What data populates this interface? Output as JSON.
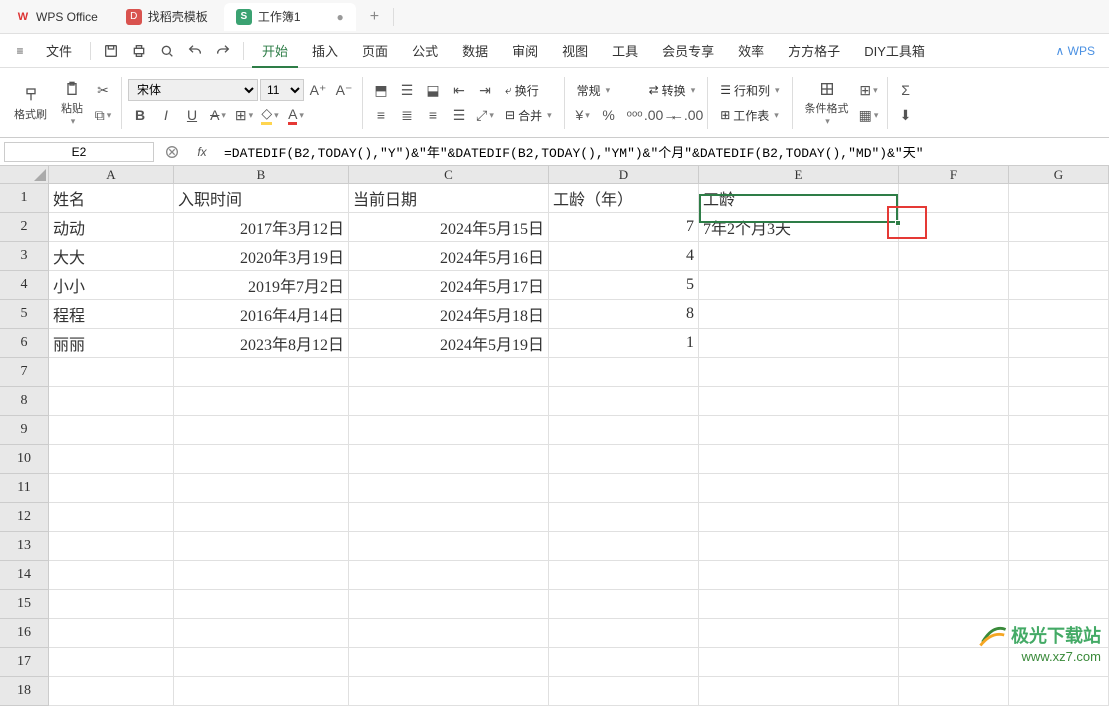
{
  "tabs": {
    "t0": "WPS Office",
    "t1": "找稻壳模板",
    "t2": "工作簿1"
  },
  "menu": {
    "file": "文件",
    "start": "开始",
    "insert": "插入",
    "page": "页面",
    "formula": "公式",
    "data": "数据",
    "review": "审阅",
    "view": "视图",
    "tools": "工具",
    "member": "会员专享",
    "efficiency": "效率",
    "fanggezi": "方方格子",
    "diy": "DIY工具箱",
    "wpsai": "WPS"
  },
  "ribbon": {
    "fmtpaint": "格式刷",
    "paste": "粘贴",
    "font": "宋体",
    "size": "11",
    "wrap": "换行",
    "merge": "合并",
    "general": "常规",
    "convert": "转换",
    "rowcol": "行和列",
    "worksheet": "工作表",
    "condfmt": "条件格式"
  },
  "namebox": "E2",
  "formula": "=DATEDIF(B2,TODAY(),\"Y\")&\"年\"&DATEDIF(B2,TODAY(),\"YM\")&\"个月\"&DATEDIF(B2,TODAY(),\"MD\")&\"天\"",
  "headers": {
    "A": "姓名",
    "B": "入职时间",
    "C": "当前日期",
    "D": "工龄（年）",
    "E": "工龄"
  },
  "rows": [
    {
      "A": "动动",
      "B": "2017年3月12日",
      "C": "2024年5月15日",
      "D": "7",
      "E": "7年2个月3天"
    },
    {
      "A": "大大",
      "B": "2020年3月19日",
      "C": "2024年5月16日",
      "D": "4",
      "E": ""
    },
    {
      "A": "小小",
      "B": "2019年7月2日",
      "C": "2024年5月17日",
      "D": "5",
      "E": ""
    },
    {
      "A": "程程",
      "B": "2016年4月14日",
      "C": "2024年5月18日",
      "D": "8",
      "E": ""
    },
    {
      "A": "丽丽",
      "B": "2023年8月12日",
      "C": "2024年5月19日",
      "D": "1",
      "E": ""
    }
  ],
  "colLabels": [
    "A",
    "B",
    "C",
    "D",
    "E",
    "F",
    "G"
  ],
  "rowLabels": [
    "1",
    "2",
    "3",
    "4",
    "5",
    "6",
    "7",
    "8",
    "9",
    "10",
    "11",
    "12",
    "13",
    "14",
    "15",
    "16",
    "17",
    "18"
  ],
  "watermark": {
    "line1": "极光下载站",
    "line2": "www.xz7.com"
  }
}
